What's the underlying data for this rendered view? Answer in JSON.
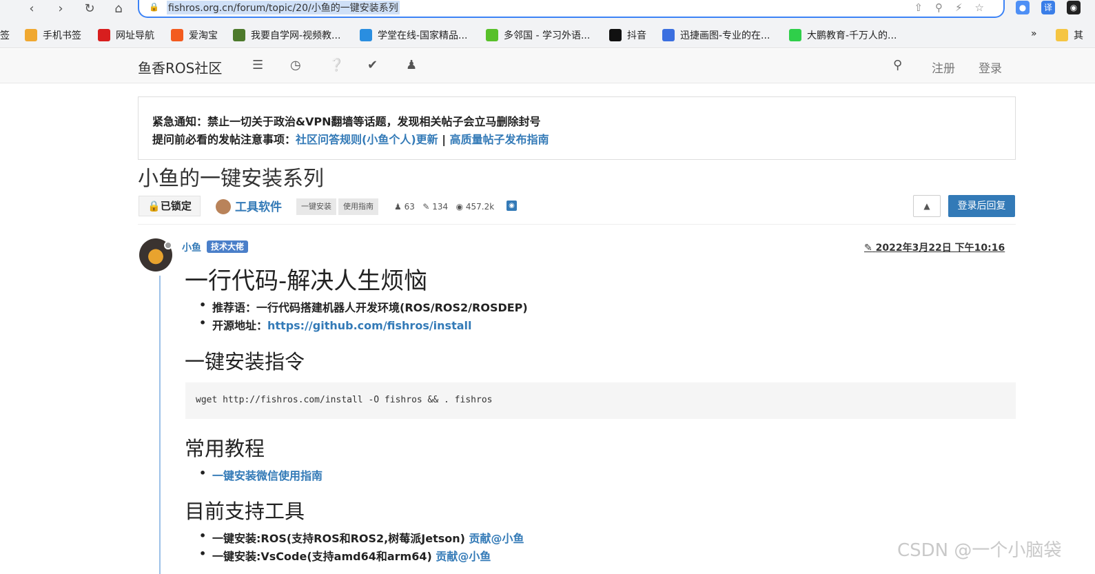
{
  "browser": {
    "url": "fishros.org.cn/forum/topic/20/小鱼的一键安装系列",
    "bookmarks": [
      "签",
      "手机书签",
      "网址导航",
      "爱淘宝",
      "我要自学网-视频教...",
      "学堂在线-国家精品...",
      "多邻国 - 学习外语...",
      "抖音",
      "迅捷画图-专业的在...",
      "大鹏教育-千万人的..."
    ],
    "more": "»",
    "trailing_bookmark": "其",
    "ext_translate": "译"
  },
  "site": {
    "brand": "鱼香ROS社区",
    "register": "注册",
    "login": "登录"
  },
  "notice": {
    "line1": "紧急通知：禁止一切关于政治&VPN翻墙等话题，发现相关帖子会立马删除封号",
    "line2_prefix": "提问前必看的发帖注意事项：",
    "link1": "社区问答规则(小鱼个人)更新",
    "sep": " | ",
    "link2": "高质量帖子发布指南"
  },
  "topic": {
    "title": "小鱼的一键安装系列",
    "locked": "已锁定",
    "category": "工具软件",
    "tags": [
      "一键安装",
      "使用指南"
    ],
    "posters": "63",
    "posts": "134",
    "views": "457.2k",
    "reply_button": "登录后回复"
  },
  "post": {
    "author": "小鱼",
    "badge": "技术大佬",
    "time": "2022年3月22日 下午10:16",
    "h1": "一行代码-解决人生烦恼",
    "li1": "推荐语：一行代码搭建机器人开发环境(ROS/ROS2/ROSDEP)",
    "li2_prefix": "开源地址：",
    "li2_link": "https://github.com/fishros/install",
    "h2_install": "一键安装指令",
    "code": "wget http://fishros.com/install -O fishros && . fishros",
    "h2_tutorial": "常用教程",
    "tutorial_link": "一键安装微信使用指南",
    "h2_tools": "目前支持工具",
    "tool1": "一键安装:ROS(支持ROS和ROS2,树莓派Jetson)",
    "tool1_link": "贡献@小鱼",
    "tool2": "一键安装:VsCode(支持amd64和arm64)",
    "tool2_link": "贡献@小鱼"
  },
  "watermark": "CSDN @一个小脑袋"
}
